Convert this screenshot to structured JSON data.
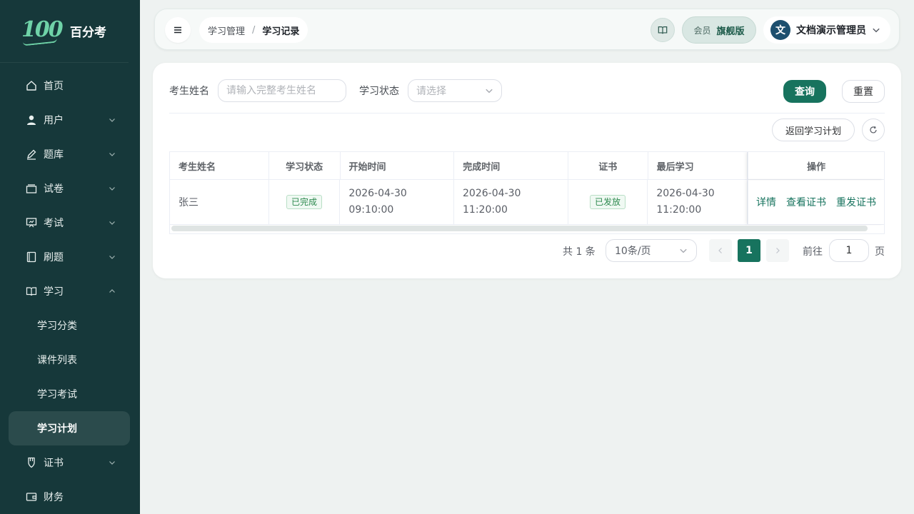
{
  "brand": {
    "logo": "100",
    "name": "百分考"
  },
  "colors": {
    "sidebar": "#16383a",
    "accent": "#17735e",
    "success_tag": "#2e8a4f"
  },
  "sidebar": {
    "items": [
      {
        "label": "首页",
        "icon": "home-icon",
        "expandable": false
      },
      {
        "label": "用户",
        "icon": "user-icon",
        "expandable": true
      },
      {
        "label": "题库",
        "icon": "edit-icon",
        "expandable": true
      },
      {
        "label": "试卷",
        "icon": "tray-icon",
        "expandable": true
      },
      {
        "label": "考试",
        "icon": "presentation-icon",
        "expandable": true
      },
      {
        "label": "刷题",
        "icon": "notebook-icon",
        "expandable": true
      },
      {
        "label": "学习",
        "icon": "book-open-icon",
        "expandable": true,
        "expanded": true
      },
      {
        "label": "证书",
        "icon": "medal-icon",
        "expandable": true
      },
      {
        "label": "财务",
        "icon": "wallet-icon",
        "expandable": false
      }
    ],
    "study_children": [
      "学习分类",
      "课件列表",
      "学习考试",
      "学习计划"
    ],
    "active_child": "学习计划"
  },
  "header": {
    "breadcrumb": [
      "学习管理",
      "学习记录"
    ],
    "breadcrumb_separator": "/",
    "vip_label": "会员",
    "vip_level": "旗舰版",
    "avatar_text": "文",
    "user_name": "文档演示管理员"
  },
  "filters": {
    "name_label": "考生姓名",
    "name_placeholder": "请输入完整考生姓名",
    "status_label": "学习状态",
    "status_placeholder": "请选择",
    "query_button": "查询",
    "reset_button": "重置"
  },
  "toolbar": {
    "back_button": "返回学习计划"
  },
  "table": {
    "columns": [
      "考生姓名",
      "学习状态",
      "开始时间",
      "完成时间",
      "证书",
      "最后学习",
      "操作"
    ],
    "rows": [
      {
        "name": "张三",
        "status": "已完成",
        "start_date": "2026-04-30",
        "start_time": "09:10:00",
        "finish_date": "2026-04-30",
        "finish_time": "11:20:00",
        "certificate": "已发放",
        "last_date": "2026-04-30",
        "last_time": "11:20:00",
        "actions": [
          "详情",
          "查看证书",
          "重发证书"
        ]
      }
    ]
  },
  "pagination": {
    "total_text": "共 1 条",
    "page_size": "10条/页",
    "current_page": "1",
    "goto_label": "前往",
    "goto_value": "1",
    "goto_suffix": "页"
  }
}
